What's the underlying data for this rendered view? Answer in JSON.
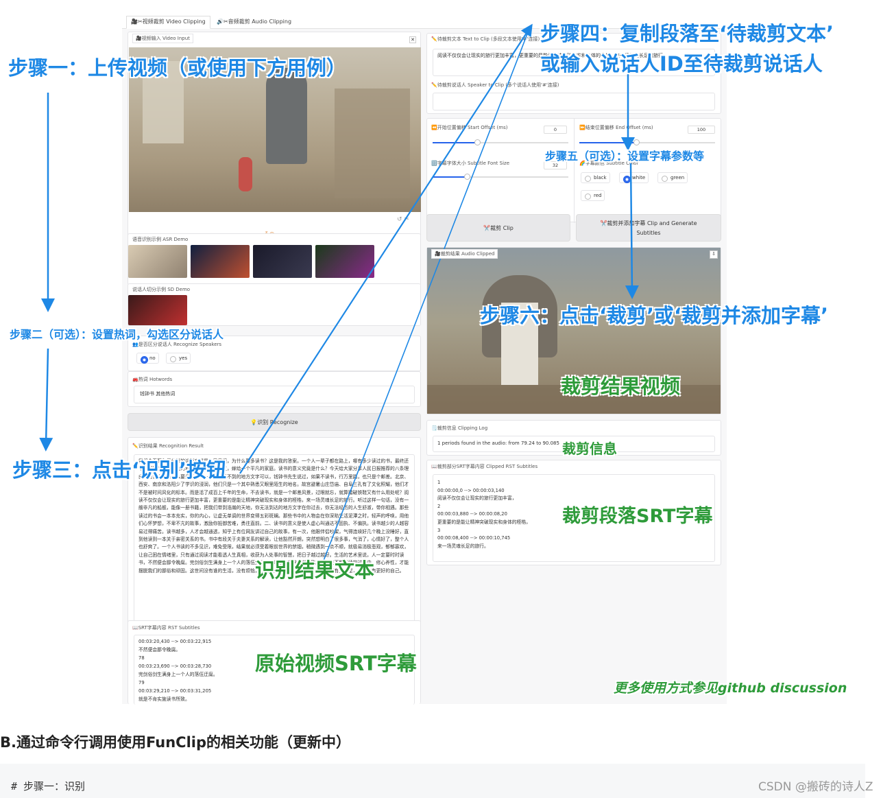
{
  "tabs": [
    {
      "label": "🎥✂视频裁剪 Video Clipping"
    },
    {
      "label": "🔊✂音频裁剪 Audio Clipping"
    }
  ],
  "video_input": {
    "label": "🎥视频输入 Video Input"
  },
  "asr_demo": {
    "label": "语音识别示例 ASR Demo"
  },
  "sd_demo": {
    "label": "说话人切分示例 SD Demo"
  },
  "speakers": {
    "label": "👥是否区分说话人 Recognize Speakers",
    "options": [
      "no",
      "yes"
    ],
    "selected": "no"
  },
  "hotwords": {
    "label": "🚒热词 Hotwords",
    "value": "钱钟书 其他热词"
  },
  "recognize_button": "💡识别 Recognize",
  "recog_result": {
    "label": "✏️识别结果 Recognition Result",
    "text": "我们今天要和您分享的这篇文章是人民日报，为什么要多读书？这是我的答案。一个人一辈子都在路上，哪有多少读过的书，最终还不是要回到一座平凡的城，打一份平凡的工，嫁给一个平凡的家庭。读书的意义究竟是什么？今天给大家分享人民日报推荐的八条理由，告诉你人为什么要多读书？一脚步丈量不到的地方文字可以，钱钟书先生说过，如果不读书，行万里路，也只是个邮差。北京、西安、南京和洛阳少了学识的浸润，他们只是一个其中熟悉又眼里陌生的地名。故宫避暑山庄岱庙、自阜三孔有了文化照耀，他们才不是被时间风化的标本。而是活了成百上千年的生命，不去读书，就是一个邮差风景，过眼就忘，就算踏破铁鞋又有什么用处呢？阅读不仅仅会让现实的旅行更加丰富，更重要的是能让精神突破现实和身体的桎梏，来一场灵魂长足的旅行。听过这样一句话，没有一艘非凡的船舰，能像一册书籍，把我们带到浩瀚的天地，你无法到达的地方文字在你过去，你无法经历的人生舒淑，带你相遇。那些读过的书会一本本充实，你的内心，让虚无单调的世界变得五彩斑斓。那些书中的人物会在你深陷生活泥潭之时，轻声的呼唤，用他们心怀梦想，不卑不亢的故事，激励你抵御苦难，勇往直前。二、读书的意义是使人虚心叫通达不固执、不偏执。读书越少的人越容易过得痛苦。读书越多，人才会越通透，知乎上有位网友讲过自己的故事，有一次，他跟伴侣吵架，气得连续好几个晚上没睡好，直到他读到一本关于亲密关系的书。书中有段关于夫妻关系的解读，让他豁然开朗，突然想明白了很多事，气消了，心情好了，整个人也舒爽了。一个人书读的不多见识，难免受限，结果就必须受着眼前世界的禁锢，稍微遇到一点不顺，就极易消极悲观，郁郁寡欢，让自己困在情绪里，只有通过阅读才能看透人生真相，收获为人处事的智慧，把日子越过越好。生活的艺术里说，人一定要时时读书，不然便会鄙令晚腐。完剑俗剑生满身上一个人的落伍迂腐，就是不肯实施读书所致。只有在不断阅读的过程中，修心养性，才能摆脱我们的鄙俗和顽固。这世间没有谁的生活，没有烦恼，唯读书是最好的解药。五、书中未必有黄金屋，但一定有更好的自己。"
  },
  "srt": {
    "label": "📖SRT字幕内容 RST Subtitles",
    "text": "00:03:20,430 --> 00:03:22,915\n不然便会鄙令晚腐。\n78\n00:03:23,690 --> 00:03:28,730\n完剑俗剑生满身上一个人的落伍迂腐。\n79\n00:03:29,210 --> 00:03:31,205\n就是不肯实施读书所致。\n80"
  },
  "clip_text": {
    "label": "✏️待裁剪文本 Text to Clip (多段文本使用'#'连接)",
    "value": "阅读不仅仅会让现实的旅行更加丰富，更重要的是能让精神突破现实和身体的桎梏，来一场灵魂长足的旅行。"
  },
  "clip_speaker": {
    "label": "✏️待裁剪说话人 Speaker to Clip (多个说话人使用'#'连接)",
    "value": ""
  },
  "start_offset": {
    "label": "⏪开始位置偏移 Start Offset (ms)",
    "value": "0",
    "fraction": 0.33
  },
  "end_offset": {
    "label": "⏩结束位置偏移 End Offset (ms)",
    "value": "100",
    "fraction": 0.42
  },
  "font_size": {
    "label": "🔠字幕字体大小 Subtitle Font Size",
    "value": "32",
    "fraction": 0.25
  },
  "font_color": {
    "label": "🌈字幕颜色 Subtitle Color",
    "options": [
      "black",
      "white",
      "green",
      "red"
    ],
    "selected": "white"
  },
  "clip_button": "✂️裁剪 Clip",
  "clip_sub_button": "✂️裁剪并添加字幕 Clip and Generate Subtitles",
  "clipped_video": {
    "label": "🎥裁剪结果 Audio Clipped"
  },
  "clip_log": {
    "label": "🗒️裁剪信息 Clipping Log",
    "value": "1 periods found in the audio: from 79.24 to 90.085"
  },
  "clip_srt": {
    "label": "📖裁剪部分SRT字幕内容 Clipped RST Subtitles",
    "text": "1\n00:00:00,0 --> 00:00:03,140\n阅读不仅仅会让现实的旅行更加丰富，\n2\n00:00:03,880 --> 00:00:08,20\n更重要的是能让精神突破现实和身体的桎梏，\n3\n00:00:08,400 --> 00:00:10,745\n来一场灵魂长足的旅行。"
  },
  "annotations": {
    "step1": "步骤一：上传视频（或使用下方用例）",
    "step2": "步骤二（可选）：设置热词，勾选区分说话人",
    "step3": "步骤三：点击‘识别’按钮",
    "step4a": "步骤四：复制段落至‘待裁剪文本’",
    "step4b": "或输入说话人ID至待裁剪说话人",
    "step5": "步骤五（可选）：设置字幕参数等",
    "step6": "步骤六：点击‘裁剪’或‘裁剪并添加字幕’",
    "clip_result_video": "裁剪结果视频",
    "clip_info": "裁剪信息",
    "clip_srt": "裁剪段落SRT字幕",
    "recog_text": "识别结果文本",
    "orig_srt": "原始视频SRT字幕",
    "more": "更多使用方式参见github discussion"
  },
  "section_heading": "B.通过命令行调用使用FunClip的相关功能（更新中）",
  "code_line": "# 步骤一：识别",
  "watermark": "CSDN @搬砖的诗人Z",
  "colors": {
    "blue": "#1e88e5",
    "green": "#2e9b3a",
    "accent": "#2563eb"
  }
}
